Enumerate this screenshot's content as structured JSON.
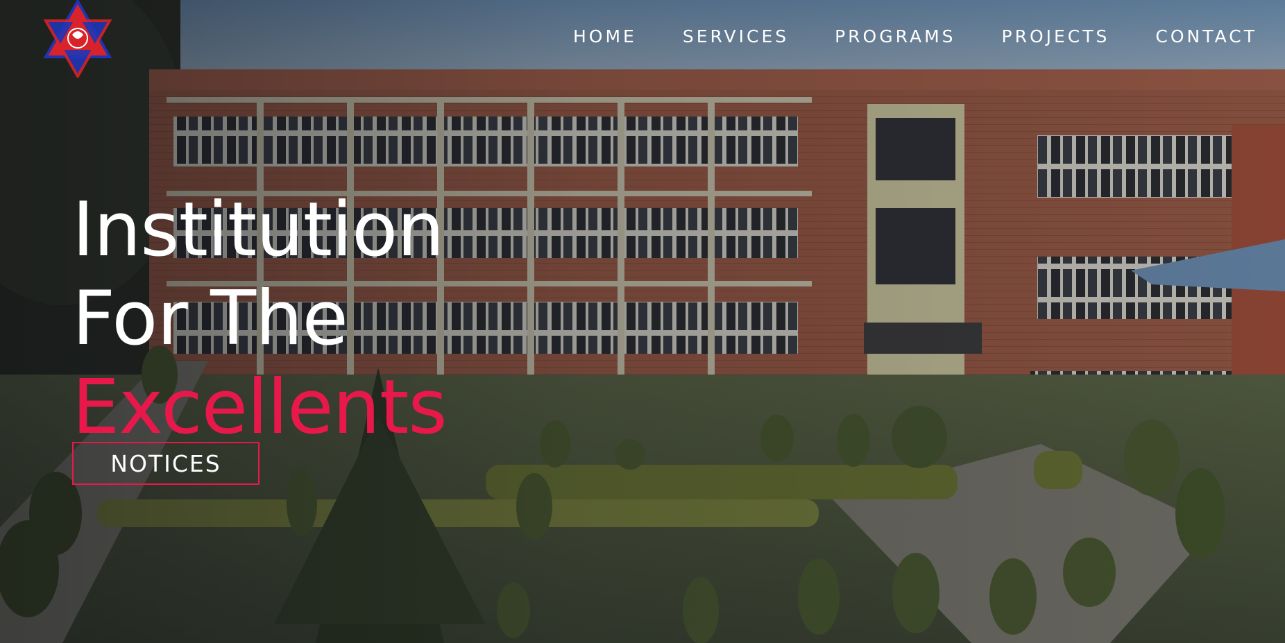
{
  "logo": {
    "icon": "university-emblem-icon"
  },
  "nav": {
    "items": [
      {
        "label": "HOME"
      },
      {
        "label": "SERVICES"
      },
      {
        "label": "PROGRAMS"
      },
      {
        "label": "PROJECTS"
      },
      {
        "label": "CONTACT"
      }
    ]
  },
  "hero": {
    "line1": "Institution",
    "line2": "For The",
    "line3": "Excellents",
    "cta_label": "NOTICES"
  },
  "colors": {
    "accent": "#e8194a",
    "text": "#ffffff",
    "brick": "#9a5a45",
    "lawn": "#4f5a3e"
  }
}
